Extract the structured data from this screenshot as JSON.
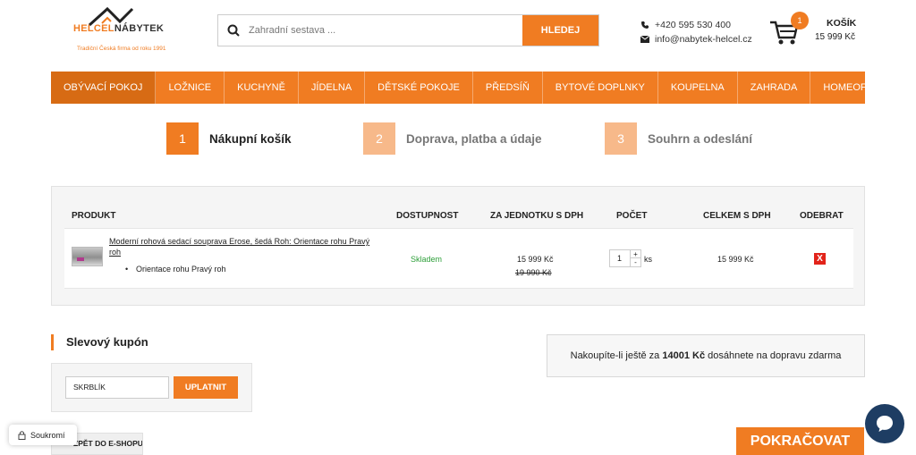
{
  "brand": {
    "name_part1": "HELCEL",
    "name_part2": "NÁBYTEK",
    "tagline": "Tradiční Česká firma od roku 1991"
  },
  "search": {
    "placeholder": "Zahradní sestava ...",
    "button_label": "HLEDEJ"
  },
  "contact": {
    "phone": "+420 595 530 400",
    "email": "info@nabytek-helcel.cz"
  },
  "cart": {
    "label": "KOŠÍK",
    "count": "1",
    "total": "15 999 Kč"
  },
  "nav": {
    "items": [
      {
        "label": "OBÝVACÍ POKOJ"
      },
      {
        "label": "LOŽNICE"
      },
      {
        "label": "KUCHYNĚ"
      },
      {
        "label": "JÍDELNA"
      },
      {
        "label": "DĚTSKÉ POKOJE"
      },
      {
        "label": "PŘEDSÍŇ"
      },
      {
        "label": "BYTOVÉ DOPLNKY"
      },
      {
        "label": "KOUPELNA"
      },
      {
        "label": "ZAHRADA"
      },
      {
        "label": "HOMEOFFICE"
      }
    ]
  },
  "steps": [
    {
      "num": "1",
      "label": "Nákupní košík"
    },
    {
      "num": "2",
      "label": "Doprava, platba a údaje"
    },
    {
      "num": "3",
      "label": "Souhrn a odeslání"
    }
  ],
  "table": {
    "headers": {
      "product": "PRODUKT",
      "availability": "DOSTUPNOST",
      "unit_price": "ZA JEDNOTKU S DPH",
      "quantity": "POČET",
      "total": "CELKEM S DPH",
      "remove": "ODEBRAT"
    },
    "rows": [
      {
        "name": "Moderní rohová sedací souprava Erose, šedá Roh: Orientace rohu Pravý roh",
        "variant": "Orientace rohu Pravý roh",
        "availability": "Skladem",
        "price": "15 999 Kč",
        "old_price": "19 990 Kč",
        "qty": "1",
        "unit": "ks",
        "total": "15 999 Kč",
        "remove_label": "X"
      }
    ]
  },
  "coupon": {
    "title": "Slevový kupón",
    "value": "SKRBLÍK",
    "button_label": "UPLATNIT"
  },
  "shipping": {
    "before": "Nakoupíte-li ještě za",
    "amount": "14001 Kč",
    "after": "dosáhnete na dopravu zdarma"
  },
  "privacy": {
    "label": "Soukromí"
  },
  "back": {
    "label": "ZPĚT DO E-SHOPU"
  },
  "continue": {
    "label": "POKRAČOVAT"
  },
  "colors": {
    "accent": "#f07c22",
    "accent_dark": "#d76b14",
    "step_inactive": "#f7b98a",
    "in_stock": "#2e9f3a",
    "remove": "#e2231a",
    "chat": "#1e3d63"
  },
  "icons": {
    "search": "search-icon",
    "phone": "phone-icon",
    "email": "mail-icon",
    "cart": "cart-icon",
    "lock": "lock-icon",
    "chat": "chat-bubble-icon"
  }
}
